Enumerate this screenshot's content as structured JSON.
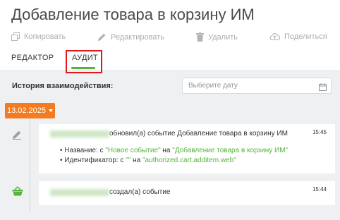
{
  "header": {
    "title": "Добавление товара в корзину ИМ"
  },
  "toolbar": {
    "copy": "Копировать",
    "edit": "Редактировать",
    "delete": "Удалить",
    "share": "Поделиться"
  },
  "tabs": [
    {
      "label": "РЕДАКТОР"
    },
    {
      "label": "АУДИТ",
      "active": true
    }
  ],
  "history": {
    "label": "История взаимодействия:",
    "date_placeholder": "Выберите дату",
    "date_badge": "13.02.2025"
  },
  "events": [
    {
      "icon": "pencil-icon",
      "text": "обновил(а) событие Добавление товара в корзину ИМ",
      "time": "15:45",
      "changes": [
        {
          "field_prefix": "Название: с ",
          "from": "\"Новое событие\"",
          "middle": " на ",
          "to": "\"Добавление товара в корзину ИМ\""
        },
        {
          "field_prefix": "Идентификатор: с ",
          "from": "\"\"",
          "middle": " на ",
          "to": "\"authorized.cart.additem.web\""
        }
      ]
    },
    {
      "icon": "basket-icon",
      "text": "создал(а) событие",
      "time": "15:44"
    }
  ],
  "colors": {
    "accent_green": "#55b53b",
    "badge_orange": "#f47b20",
    "highlight_red": "#e01a1a"
  }
}
